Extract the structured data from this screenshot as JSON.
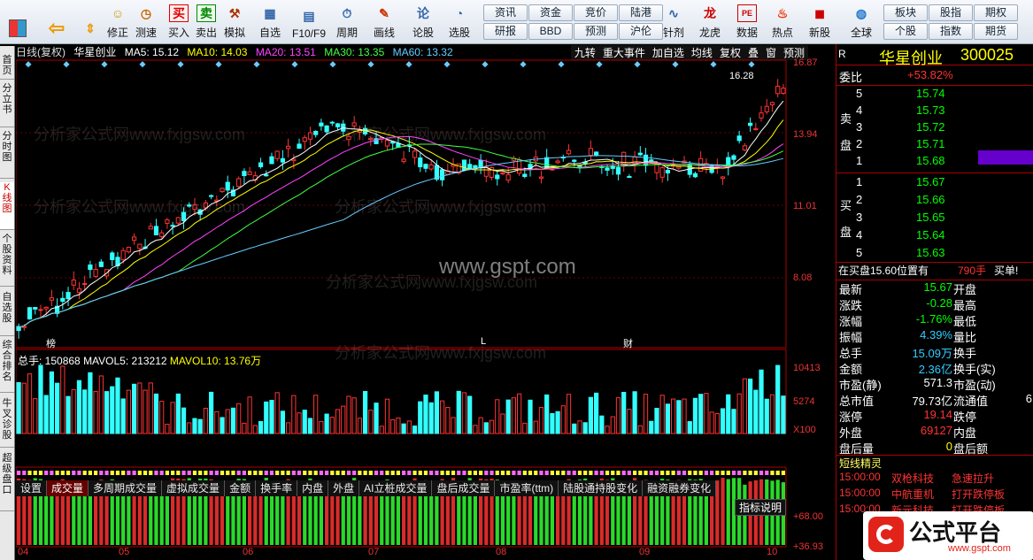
{
  "toolbar": {
    "buttons": [
      "修正",
      "测速",
      "买入",
      "卖出",
      "模拟",
      "自选",
      "F10/F9",
      "周期",
      "画线",
      "论股",
      "选股",
      "针剂",
      "龙虎",
      "数据",
      "热点",
      "新股",
      "全球"
    ],
    "grid_top": [
      "资讯",
      "资金",
      "竞价",
      "陆港",
      "板块",
      "股指",
      "期权"
    ],
    "grid_bottom": [
      "研报",
      "BBD",
      "预测",
      "沪伦",
      "个股",
      "指数",
      "期货"
    ]
  },
  "left_tabs": [
    "首页",
    "分立书",
    "分时图",
    "K线图",
    "个股资料",
    "自选股",
    "综合排名",
    "牛叉诊股",
    "超级盘口"
  ],
  "chart": {
    "period": "日线(复权)",
    "name": "华星创业",
    "ma5": "MA5: 15.12",
    "ma10": "MA10: 14.03",
    "ma20": "MA20: 13.51",
    "ma30": "MA30: 13.35",
    "ma60": "MA60: 13.32",
    "buttons": [
      "九转",
      "重大事件",
      "加自选",
      "均线",
      "复权",
      "叠",
      "窗",
      "预测"
    ],
    "price_labels": [
      "16.87",
      "13.94",
      "11.01",
      "8.08"
    ],
    "high_label": "16.28",
    "markers": [
      "榜",
      "L",
      "财"
    ],
    "vol_header": "总手: 150868",
    "vol_ma5": "MAVOL5: 213212",
    "vol_ma10": "MAVOL10: 13.76万",
    "vol_labels": [
      "10413",
      "5274",
      "X100"
    ],
    "indicator_button": "指标说明",
    "ind_labels": [
      "+68.00",
      "+36.93"
    ],
    "tabs": [
      "设置",
      "成交量",
      "多周期成交量",
      "虚拟成交量",
      "金额",
      "换手率",
      "内盘",
      "外盘",
      "AI立桩成交量",
      "盘后成交量",
      "市盈率(ttm)",
      "陆股通持股变化",
      "融资融券变化"
    ],
    "months": [
      "04",
      "05",
      "06",
      "07",
      "08",
      "09",
      "10"
    ],
    "watermark_site": "www.gspt.com",
    "watermark_text": "分析家公式网www.fxjgsw.com"
  },
  "panel": {
    "title": "华星创业",
    "code": "300025",
    "weibi_label": "委比",
    "weibi_value": "+53.82%",
    "sell": [
      [
        "5",
        "15.74"
      ],
      [
        "4",
        "15.73"
      ],
      [
        "3",
        "15.72"
      ],
      [
        "2",
        "15.71"
      ],
      [
        "1",
        "15.68"
      ]
    ],
    "buy": [
      [
        "1",
        "15.67"
      ],
      [
        "2",
        "15.66"
      ],
      [
        "3",
        "15.65"
      ],
      [
        "4",
        "15.64"
      ],
      [
        "5",
        "15.63"
      ]
    ],
    "sell_label": "卖盘",
    "buy_label": "买盘",
    "position": "在买盘15.60位置有",
    "position_vol": "790手",
    "position_tag": "买单!",
    "stats": [
      [
        "最新",
        "15.67",
        "开盘",
        ""
      ],
      [
        "涨跌",
        "-0.28",
        "最高",
        ""
      ],
      [
        "涨幅",
        "-1.76%",
        "最低",
        ""
      ],
      [
        "振幅",
        "4.39%",
        "量比",
        ""
      ],
      [
        "总手",
        "15.09万",
        "换手",
        ""
      ],
      [
        "金额",
        "2.36亿",
        "换手(实)",
        ""
      ],
      [
        "市盈(静)",
        "571.3",
        "市盈(动)",
        ""
      ],
      [
        "总市值",
        "79.73亿",
        "流通值",
        "6"
      ],
      [
        "涨停",
        "19.14",
        "跌停",
        ""
      ],
      [
        "外盘",
        "69127",
        "内盘",
        ""
      ],
      [
        "盘后量",
        "0",
        "盘后额",
        ""
      ]
    ],
    "wizard_title": "短线精灵",
    "wizard": [
      [
        "15:00:00",
        "双枪科技",
        "急速拉升"
      ],
      [
        "15:00:00",
        "中航重机",
        "打开跌停板"
      ],
      [
        "15:00:00",
        "新元科技",
        "打开跌停板"
      ]
    ],
    "logo": "公式平台",
    "logo_url": "www.gspt.com"
  }
}
